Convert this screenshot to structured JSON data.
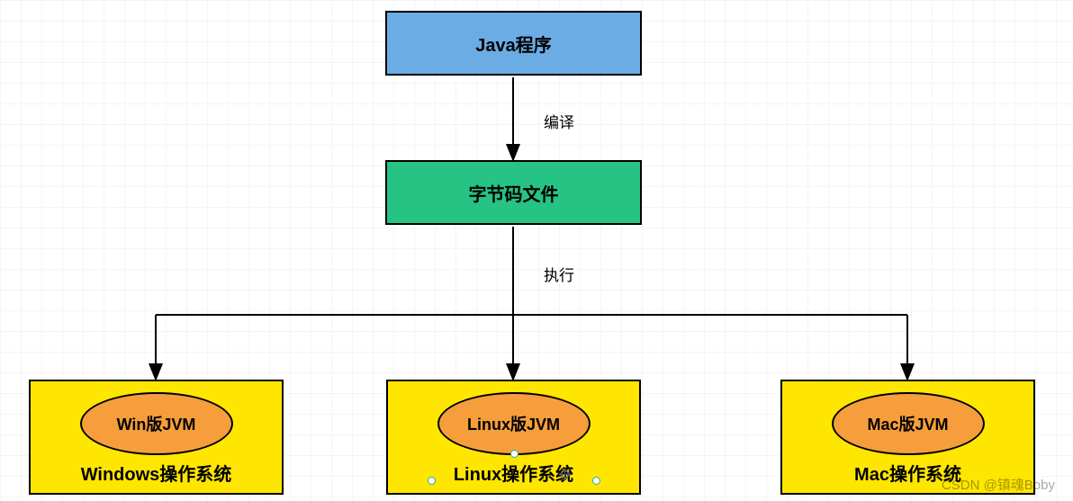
{
  "top_box": {
    "label": "Java程序"
  },
  "mid_box": {
    "label": "字节码文件"
  },
  "edge1_label": "编译",
  "edge2_label": "执行",
  "platforms": [
    {
      "jvm": "Win版JVM",
      "os": "Windows操作系统"
    },
    {
      "jvm": "Linux版JVM",
      "os": "Linux操作系统"
    },
    {
      "jvm": "Mac版JVM",
      "os": "Mac操作系统"
    }
  ],
  "watermark": "CSDN @镇魂Boby",
  "handles": {
    "bottom_center": true,
    "left": true,
    "right": true,
    "rotate_icon": true
  }
}
